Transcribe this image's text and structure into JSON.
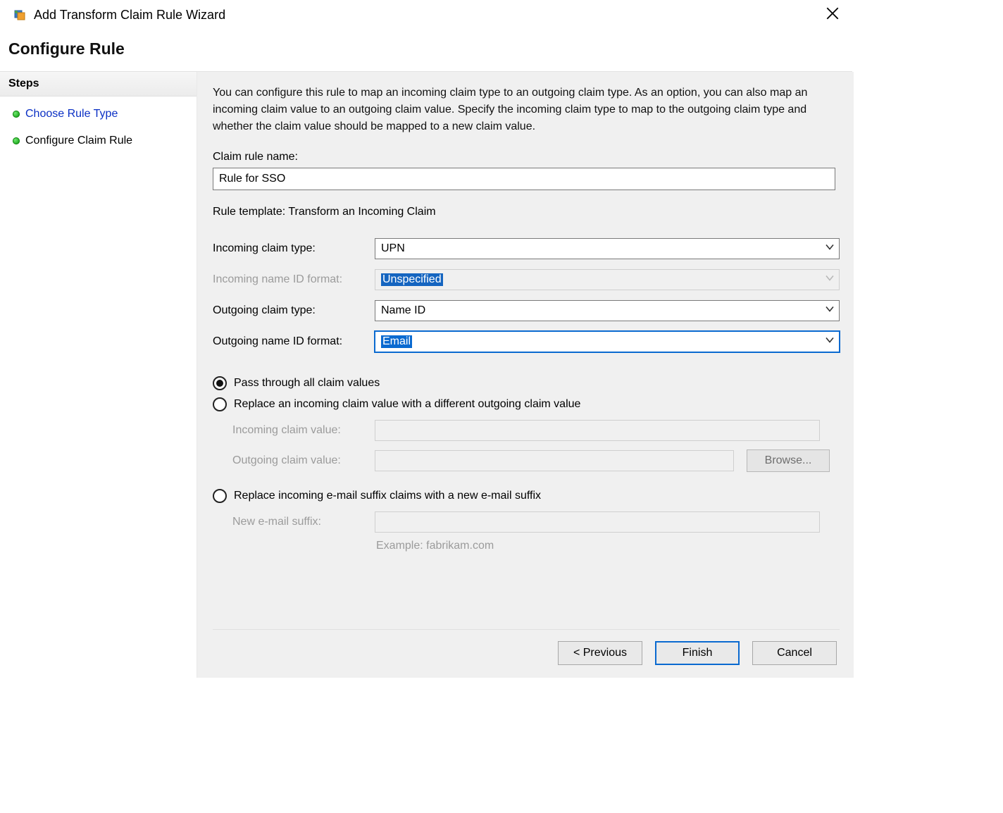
{
  "titlebar": {
    "title": "Add Transform Claim Rule Wizard"
  },
  "heading": "Configure Rule",
  "sidebar": {
    "header": "Steps",
    "items": [
      {
        "label": "Choose Rule Type",
        "link": true
      },
      {
        "label": "Configure Claim Rule",
        "link": false
      }
    ]
  },
  "main": {
    "intro": "You can configure this rule to map an incoming claim type to an outgoing claim type. As an option, you can also map an incoming claim value to an outgoing claim value. Specify the incoming claim type to map to the outgoing claim type and whether the claim value should be mapped to a new claim value.",
    "claim_rule_name_label": "Claim rule name:",
    "claim_rule_name_value": "Rule for SSO",
    "rule_template_line": "Rule template: Transform an Incoming Claim",
    "incoming_claim_type_label": "Incoming claim type:",
    "incoming_claim_type_value": "UPN",
    "incoming_nameid_format_label": "Incoming name ID format:",
    "incoming_nameid_format_value": "Unspecified",
    "outgoing_claim_type_label": "Outgoing claim type:",
    "outgoing_claim_type_value": "Name ID",
    "outgoing_nameid_format_label": "Outgoing name ID format:",
    "outgoing_nameid_format_value": "Email",
    "radios": {
      "pass_through": "Pass through all claim values",
      "replace_value": "Replace an incoming claim value with a different outgoing claim value",
      "replace_suffix": "Replace incoming e-mail suffix claims with a new e-mail suffix"
    },
    "sub": {
      "incoming_value_label": "Incoming claim value:",
      "outgoing_value_label": "Outgoing claim value:",
      "browse_label": "Browse...",
      "new_suffix_label": "New e-mail suffix:",
      "example": "Example: fabrikam.com"
    }
  },
  "buttons": {
    "previous": "< Previous",
    "finish": "Finish",
    "cancel": "Cancel"
  }
}
